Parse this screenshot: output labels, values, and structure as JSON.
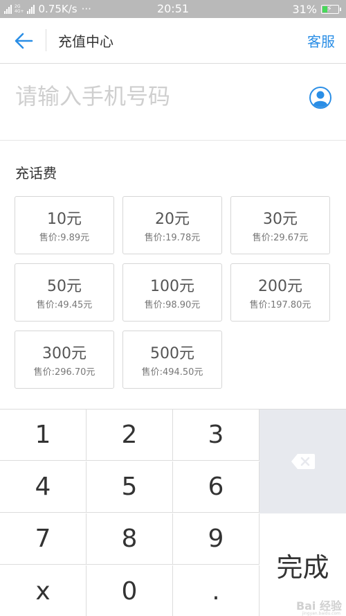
{
  "status_bar": {
    "net_tag_top": "2G",
    "net_tag_mid": "4G+",
    "speed": "0.75K/s",
    "dots": "···",
    "time": "20:51",
    "battery": "31%"
  },
  "header": {
    "title": "充值中心",
    "service": "客服"
  },
  "phone": {
    "placeholder": "请输入手机号码",
    "value": ""
  },
  "section": {
    "title": "充话费"
  },
  "cards": [
    {
      "amount": "10元",
      "price": "售价:9.89元"
    },
    {
      "amount": "20元",
      "price": "售价:19.78元"
    },
    {
      "amount": "30元",
      "price": "售价:29.67元"
    },
    {
      "amount": "50元",
      "price": "售价:49.45元"
    },
    {
      "amount": "100元",
      "price": "售价:98.90元"
    },
    {
      "amount": "200元",
      "price": "售价:197.80元"
    },
    {
      "amount": "300元",
      "price": "售价:296.70元"
    },
    {
      "amount": "500元",
      "price": "售价:494.50元"
    }
  ],
  "keypad": {
    "keys": [
      "1",
      "2",
      "3",
      "4",
      "5",
      "6",
      "7",
      "8",
      "9",
      "x",
      "0",
      "."
    ],
    "done": "完成"
  },
  "watermark": {
    "text": "Bai 经验",
    "sub": "jingyan.baidu.com"
  },
  "colors": {
    "accent": "#2a8ee6",
    "status_bar": "#b9b9b9",
    "delete_key_bg": "#e7e9ee"
  }
}
